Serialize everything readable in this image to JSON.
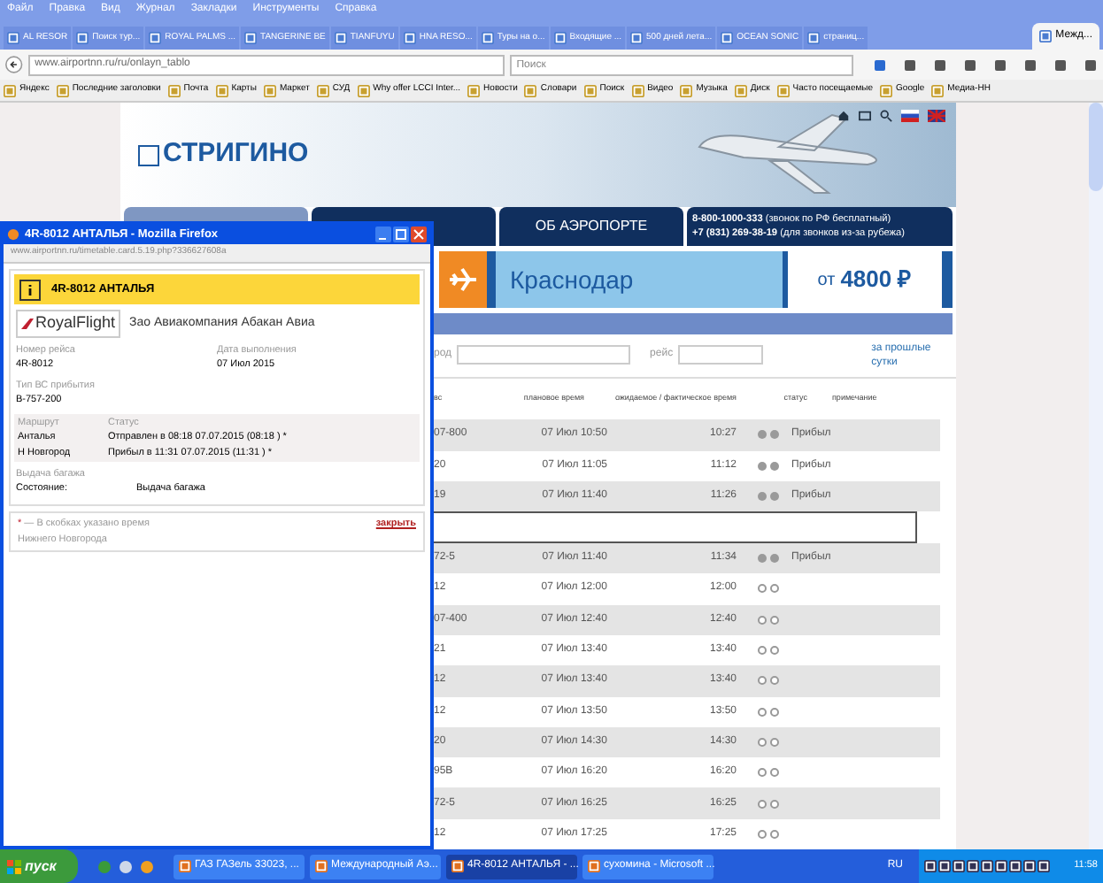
{
  "menu": [
    "Файл",
    "Правка",
    "Вид",
    "Журнал",
    "Закладки",
    "Инструменты",
    "Справка"
  ],
  "tabs": [
    {
      "label": "AL RESOR",
      "selected": false
    },
    {
      "label": "Поиск тур...",
      "selected": false
    },
    {
      "label": "ROYAL PALMS ...",
      "selected": false
    },
    {
      "label": "TANGERINE BE",
      "selected": false
    },
    {
      "label": "TIANFUYU",
      "selected": false
    },
    {
      "label": "HNA RESO...",
      "selected": false
    },
    {
      "label": "Туры на о...",
      "selected": false
    },
    {
      "label": "Входящие ...",
      "selected": false
    },
    {
      "label": "500 дней лета...",
      "selected": false
    },
    {
      "label": "OCEAN SONIC",
      "selected": false
    },
    {
      "label": "страниц...",
      "selected": false
    },
    {
      "label": "Межд...",
      "selected": true
    }
  ],
  "address": {
    "value": "www.airportnn.ru/ru/onlayn_tablo"
  },
  "search": {
    "placeholder": "Поиск"
  },
  "bookmarks": [
    "Яндекс",
    "Последние заголовки",
    "Почта",
    "Карты",
    "Маркет",
    "СУД",
    "Why offer LCCI Inter...",
    "Новости",
    "Словари",
    "Поиск",
    "Видео",
    "Музыка",
    "Диск",
    "Часто посещаемые",
    "Google",
    "Медиа-НН"
  ],
  "site": {
    "logo": "СТРИГИНО",
    "nav": [
      {
        "selected": true
      },
      {
        "selected": false
      },
      {
        "label": "ОБ АЭРОПОРТЕ",
        "selected": false
      }
    ],
    "phones": [
      "**8-800-1000-333** (звонок по РФ бесплатный)",
      "**+7 (831) 269-38-19** (для звонков из-за рубежа)"
    ],
    "banner": {
      "city": "Краснодар",
      "price_prefix": "от",
      "price": "4800 ₽"
    },
    "filter": {
      "city_label": "род",
      "flight_label": "рейс",
      "link": "за прошлые сутки"
    },
    "columns": [
      "вс",
      "плановое время",
      "ожидаемое / фактическое время",
      "статус",
      "примечание"
    ],
    "rows": [
      {
        "kind": "flight",
        "aircraft": "07-800",
        "planned": "07 Июл 10:50",
        "actual": "10:27",
        "passed": true,
        "status": "Прибыл"
      },
      {
        "kind": "flight",
        "aircraft": "20",
        "planned": "07 Июл 11:05",
        "actual": "11:12",
        "passed": true,
        "status": "Прибыл"
      },
      {
        "kind": "flight",
        "aircraft": "19",
        "planned": "07 Июл 11:40",
        "actual": "11:26",
        "passed": true,
        "status": "Прибыл"
      },
      {
        "kind": "detail"
      },
      {
        "kind": "flight",
        "aircraft": "72-5",
        "planned": "07 Июл 11:40",
        "actual": "11:34",
        "passed": true,
        "status": "Прибыл"
      },
      {
        "kind": "flight",
        "aircraft": "12",
        "planned": "07 Июл 12:00",
        "actual": "12:00",
        "passed": false
      },
      {
        "kind": "flight",
        "aircraft": "07-400",
        "planned": "07 Июл 12:40",
        "actual": "12:40",
        "passed": false
      },
      {
        "kind": "flight",
        "aircraft": "21",
        "planned": "07 Июл 13:40",
        "actual": "13:40",
        "passed": false
      },
      {
        "kind": "flight",
        "aircraft": "12",
        "planned": "07 Июл 13:40",
        "actual": "13:40",
        "passed": false
      },
      {
        "kind": "flight",
        "aircraft": "12",
        "planned": "07 Июл 13:50",
        "actual": "13:50",
        "passed": false
      },
      {
        "kind": "flight",
        "aircraft": "20",
        "planned": "07 Июл 14:30",
        "actual": "14:30",
        "passed": false
      },
      {
        "kind": "flight",
        "aircraft": "95B",
        "planned": "07 Июл 16:20",
        "actual": "16:20",
        "passed": false
      },
      {
        "kind": "flight",
        "aircraft": "72-5",
        "planned": "07 Июл 16:25",
        "actual": "16:25",
        "passed": false
      },
      {
        "kind": "flight",
        "aircraft": "12",
        "planned": "07 Июл 17:25",
        "actual": "17:25",
        "passed": false
      }
    ]
  },
  "popup": {
    "title": "4R-8012 АНТАЛЬЯ - Mozilla Firefox",
    "url": "www.airportnn.ru/timetable.card.5.19.php?336627608a",
    "heading": "4R-8012 АНТАЛЬЯ",
    "airline_logo": "RoyalFlight",
    "airline": "Зао Авиакомпания Абакан Авиа",
    "fields": [
      {
        "label": "Номер рейса",
        "value": "4R-8012"
      },
      {
        "label": "Дата выполнения",
        "value": "07 Июл 2015"
      }
    ],
    "aircraft": {
      "label": "Тип ВС прибытия",
      "value": "B-757-200"
    },
    "route": {
      "label": "Маршрут",
      "points": [
        "Анталья",
        "Н Новгород"
      ],
      "status_label": "Статус",
      "statuses": [
        "Отправлен в 08:18 07.07.2015 (08:18 ) *",
        "Прибыл в 11:31 07.07.2015 (11:31 ) *"
      ]
    },
    "baggage": {
      "label": "Выдача багажа",
      "state_label": "Состояние:",
      "state": "Выдача багажа"
    },
    "note": [
      "*",
      "— В скобках указано время Нижнего Новгорода"
    ],
    "close": "закрыть"
  },
  "taskbar": {
    "start": "пуск",
    "tasks": [
      {
        "label": "ГАЗ ГАЗель 33023, ...",
        "selected": false
      },
      {
        "label": "Международный Аэ...",
        "selected": false
      },
      {
        "label": "4R-8012 АНТАЛЬЯ - ...",
        "selected": true
      },
      {
        "label": "сухомина - Microsoft ...",
        "selected": false
      }
    ],
    "lang": "RU",
    "clock": "11:58"
  }
}
